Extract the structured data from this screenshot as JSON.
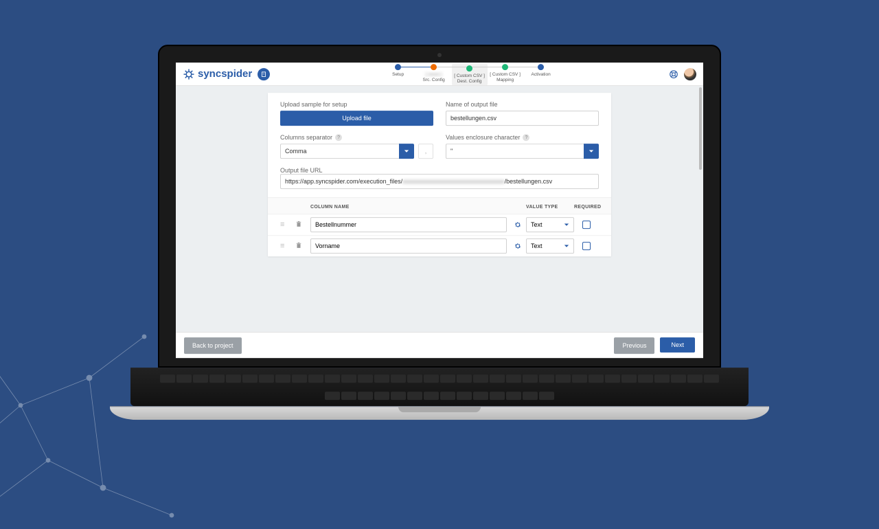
{
  "brand": {
    "name": "syncspider"
  },
  "stepper": {
    "steps": [
      {
        "label": "Setup",
        "color": "blue"
      },
      {
        "label": "Src. Config",
        "color": "orange",
        "blurred_prefix": true
      },
      {
        "label": "[ Custom CSV ]\nDest. Config",
        "color": "green",
        "active": true
      },
      {
        "label": "[ Custom CSV ]\nMapping",
        "color": "green"
      },
      {
        "label": "Activation",
        "color": "blue"
      }
    ]
  },
  "form": {
    "upload_label": "Upload sample for setup",
    "upload_button": "Upload file",
    "output_name_label": "Name of output file",
    "output_name_value": "bestellungen.csv",
    "separator_label": "Columns separator",
    "separator_value": "Comma",
    "separator_extra": ",",
    "enclosure_label": "Values enclosure character",
    "enclosure_value": "\"",
    "url_label": "Output file URL",
    "url_prefix": "https://app.syncspider.com/execution_files/",
    "url_blurred": "xxxxxxxxxxxxxxxxxxxxxxxxxxxxxxxxx",
    "url_suffix": "/bestellungen.csv"
  },
  "table": {
    "headers": {
      "name": "COLUMN NAME",
      "type": "VALUE TYPE",
      "required": "REQUIRED"
    },
    "rows": [
      {
        "name": "Bestellnummer",
        "type": "Text",
        "required": false
      },
      {
        "name": "Vorname",
        "type": "Text",
        "required": false
      }
    ]
  },
  "footer": {
    "back": "Back to project",
    "previous": "Previous",
    "next": "Next"
  }
}
